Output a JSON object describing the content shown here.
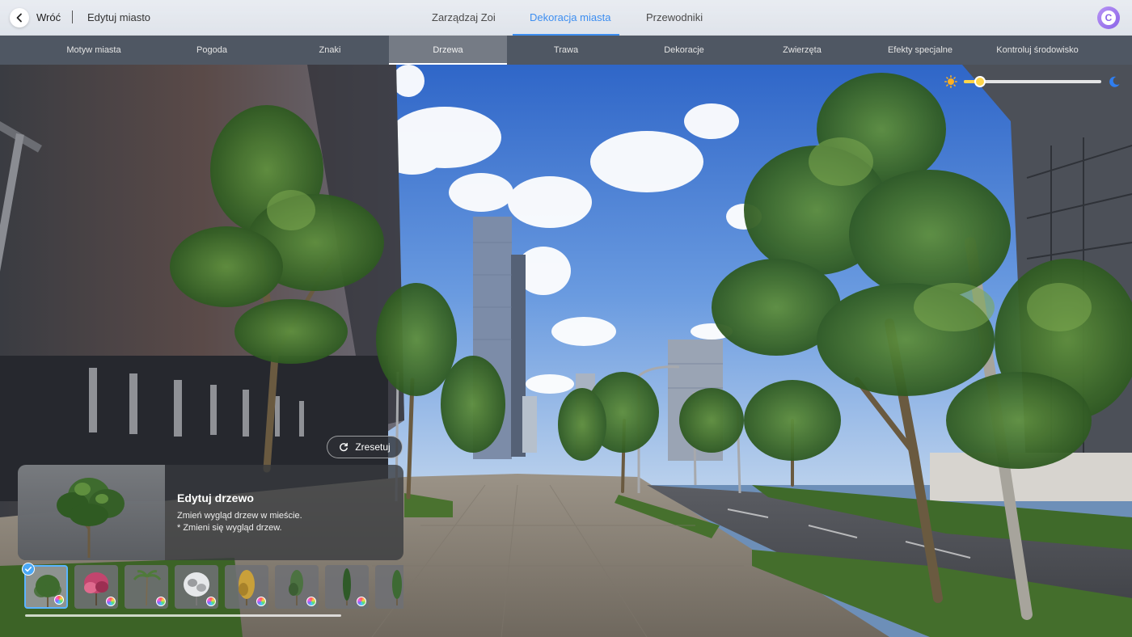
{
  "topbar": {
    "back_label": "Wróć",
    "page_title": "Edytuj miasto",
    "tabs": [
      {
        "label": "Zarządzaj Zoi"
      },
      {
        "label": "Dekoracja miasta"
      },
      {
        "label": "Przewodniki"
      }
    ],
    "active_tab": "Dekoracja miasta",
    "avatar_letter": "C"
  },
  "subtabs": [
    {
      "label": "Motyw miasta"
    },
    {
      "label": "Pogoda"
    },
    {
      "label": "Znaki"
    },
    {
      "label": "Drzewa"
    },
    {
      "label": "Trawa"
    },
    {
      "label": "Dekoracje"
    },
    {
      "label": "Zwierzęta"
    },
    {
      "label": "Efekty specjalne"
    },
    {
      "label": "Kontroluj środowisko"
    }
  ],
  "active_subtab": "Drzewa",
  "time_of_day": {
    "value": 0.12,
    "icons": [
      "sun-icon",
      "moon-icon"
    ]
  },
  "reset_button": {
    "label": "Zresetuj",
    "icon": "refresh-icon"
  },
  "edit_panel": {
    "title": "Edytuj drzewo",
    "description_line1": "Zmień wygląd drzew w mieście.",
    "description_line2": "* Zmieni się wygląd drzew."
  },
  "tree_options": [
    {
      "name": "tree-option-green-broadleaf",
      "selected": true,
      "color": "#3e6b2e"
    },
    {
      "name": "tree-option-pink-blossom",
      "selected": false,
      "color": "#c2456e"
    },
    {
      "name": "tree-option-palm",
      "selected": false,
      "color": "#4f7a3a"
    },
    {
      "name": "tree-option-white-frost",
      "selected": false,
      "color": "#e6e8ea"
    },
    {
      "name": "tree-option-yellow-autumn",
      "selected": false,
      "color": "#c9a03a"
    },
    {
      "name": "tree-option-slender",
      "selected": false,
      "color": "#4c7241"
    },
    {
      "name": "tree-option-cypress",
      "selected": false,
      "color": "#2f5a28"
    },
    {
      "name": "tree-option-tall",
      "selected": false,
      "color": "#3d6a33"
    }
  ],
  "colors": {
    "accent": "#3d8ef0",
    "slider_fill": "#ffd54a",
    "selected_border": "#5ab4ff"
  }
}
